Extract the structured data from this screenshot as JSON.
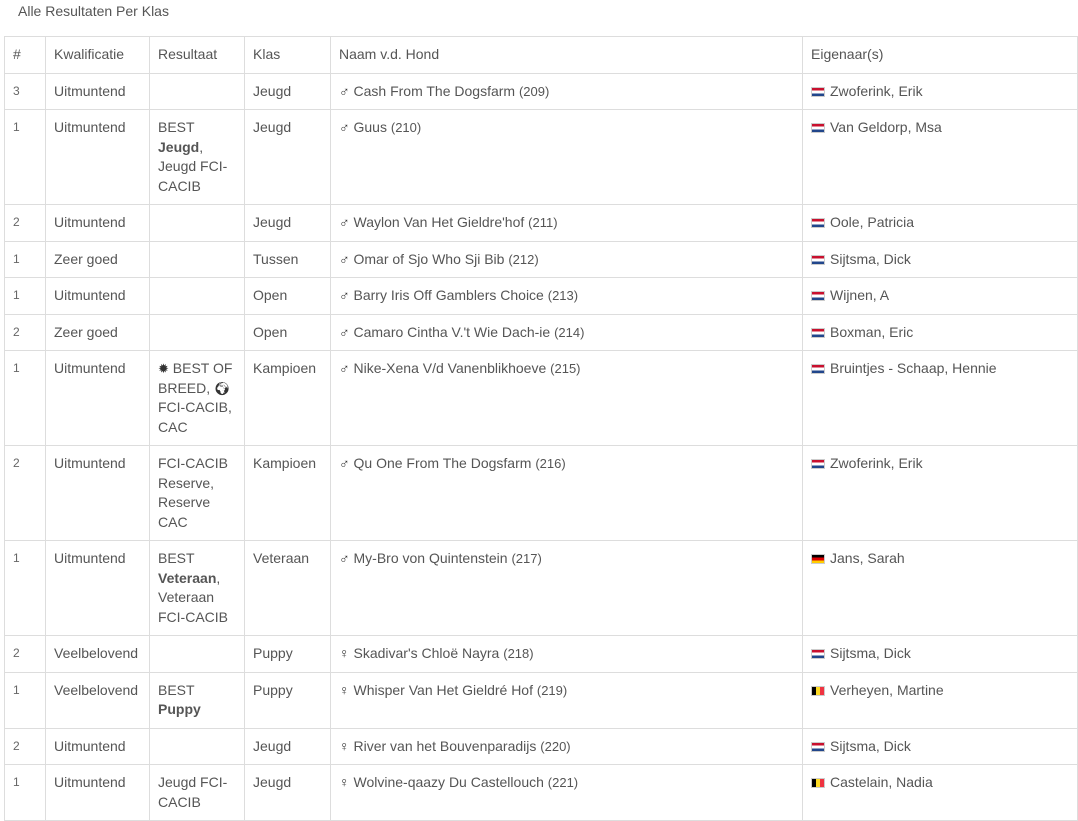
{
  "page": {
    "title": "Alle Resultaten Per Klas"
  },
  "table": {
    "headers": {
      "num": "#",
      "kwalificatie": "Kwalificatie",
      "resultaat": "Resultaat",
      "klas": "Klas",
      "naam": "Naam v.d. Hond",
      "eigenaar": "Eigenaar(s)"
    },
    "rows": [
      {
        "num": "3",
        "kwal": "Uitmuntend",
        "klas": "Jeugd",
        "sex": "♂",
        "name": "Cash From The Dogsfarm",
        "cat": "(209)",
        "flag": "nl",
        "owner": "Zwoferink, Erik"
      },
      {
        "num": "1",
        "kwal": "Uitmuntend",
        "res_a": "BEST",
        "res_b": "Jeugd",
        "res_c": ", Jeugd FCI-CACIB",
        "klas": "Jeugd",
        "sex": "♂",
        "name": "Guus",
        "cat": "(210)",
        "flag": "nl",
        "owner": "Van Geldorp, Msa"
      },
      {
        "num": "2",
        "kwal": "Uitmuntend",
        "klas": "Jeugd",
        "sex": "♂",
        "name": "Waylon Van Het Gieldre'hof",
        "cat": "(211)",
        "flag": "nl",
        "owner": "Oole, Patricia"
      },
      {
        "num": "1",
        "kwal": "Zeer goed",
        "klas": "Tussen",
        "sex": "♂",
        "name": "Omar of Sjo Who Sji Bib",
        "cat": "(212)",
        "flag": "nl",
        "owner": "Sijtsma, Dick"
      },
      {
        "num": "1",
        "kwal": "Uitmuntend",
        "klas": "Open",
        "sex": "♂",
        "name": "Barry Iris Off Gamblers Choice",
        "cat": "(213)",
        "flag": "nl",
        "owner": "Wijnen, A"
      },
      {
        "num": "2",
        "kwal": "Zeer goed",
        "klas": "Open",
        "sex": "♂",
        "name": "Camaro Cintha V.'t Wie Dach-ie",
        "cat": "(214)",
        "flag": "nl",
        "owner": "Boxman, Eric"
      },
      {
        "num": "1",
        "kwal": "Uitmuntend",
        "res_a": "BEST OF BREED,",
        "res_b": "FCI-CACIB, CAC",
        "icon_a": "sun-burst-icon",
        "icon_b": "globe-icon",
        "klas": "Kampioen",
        "sex": "♂",
        "name": "Nike-Xena V/d Vanenblikhoeve",
        "cat": "(215)",
        "flag": "nl",
        "owner": "Bruintjes - Schaap, Hennie"
      },
      {
        "num": "2",
        "kwal": "Uitmuntend",
        "res_a": "FCI-CACIB Reserve, Reserve CAC",
        "klas": "Kampioen",
        "sex": "♂",
        "name": "Qu One From The Dogsfarm",
        "cat": "(216)",
        "flag": "nl",
        "owner": "Zwoferink, Erik"
      },
      {
        "num": "1",
        "kwal": "Uitmuntend",
        "res_a": "BEST",
        "res_b": "Veteraan",
        "res_c": ", Veteraan FCI-CACIB",
        "klas": "Veteraan",
        "sex": "♂",
        "name": "My-Bro von Quintenstein",
        "cat": "(217)",
        "flag": "de",
        "owner": "Jans, Sarah"
      },
      {
        "num": "2",
        "kwal": "Veelbelovend",
        "klas": "Puppy",
        "sex": "♀",
        "name": "Skadivar's Chloë Nayra",
        "cat": "(218)",
        "flag": "nl",
        "owner": "Sijtsma, Dick"
      },
      {
        "num": "1",
        "kwal": "Veelbelovend",
        "res_a": "BEST",
        "res_b": "Puppy",
        "klas": "Puppy",
        "sex": "♀",
        "name": "Whisper Van Het Gieldré Hof",
        "cat": "(219)",
        "flag": "be",
        "owner": "Verheyen, Martine"
      },
      {
        "num": "2",
        "kwal": "Uitmuntend",
        "klas": "Jeugd",
        "sex": "♀",
        "name": "River van het Bouvenparadijs",
        "cat": "(220)",
        "flag": "nl",
        "owner": "Sijtsma, Dick"
      },
      {
        "num": "1",
        "kwal": "Uitmuntend",
        "res_a": "Jeugd FCI-CACIB",
        "klas": "Jeugd",
        "sex": "♀",
        "name": "Wolvine-qaazy Du Castellouch",
        "cat": "(221)",
        "flag": "be",
        "owner": "Castelain, Nadia"
      }
    ]
  }
}
